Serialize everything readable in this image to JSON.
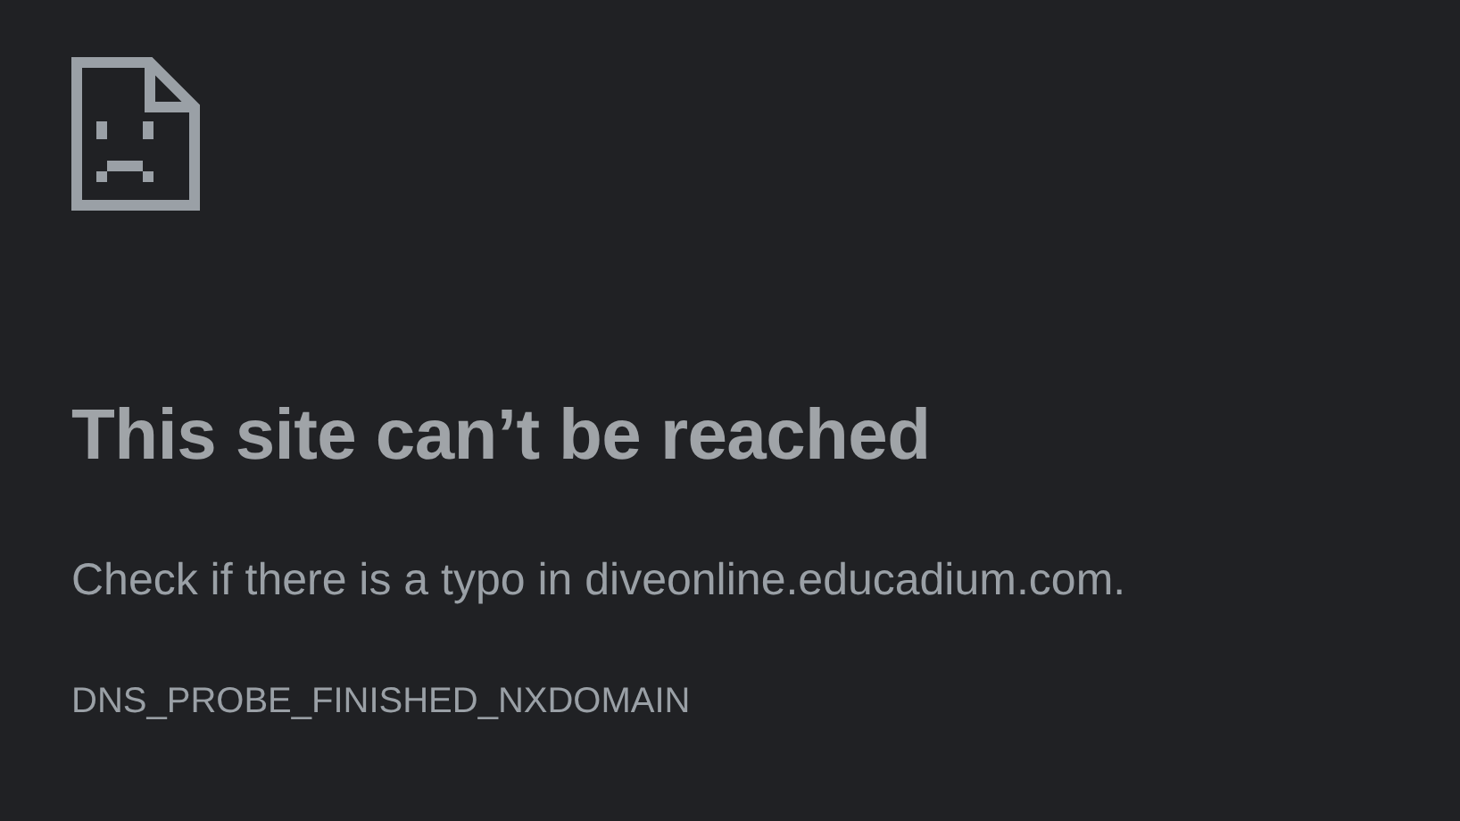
{
  "error_page": {
    "title": "This site can’t be reached",
    "message": "Check if there is a typo in diveonline.educadium.com.",
    "error_code": "DNS_PROBE_FINISHED_NXDOMAIN"
  }
}
